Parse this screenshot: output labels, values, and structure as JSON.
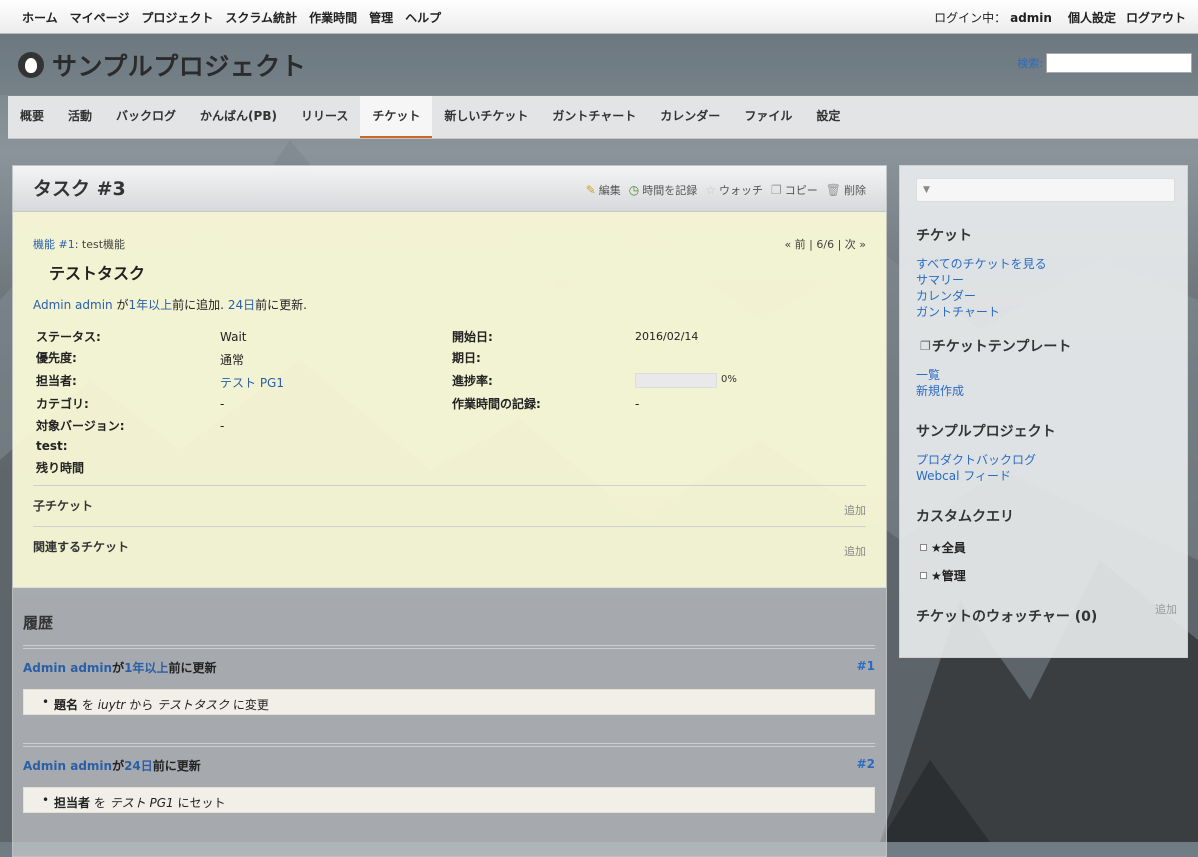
{
  "top_menu": {
    "items": [
      "ホーム",
      "マイページ",
      "プロジェクト",
      "スクラム統計",
      "作業時間",
      "管理",
      "ヘルプ"
    ],
    "logged_in_label": "ログイン中：",
    "user": "admin",
    "my_account": "個人設定",
    "logout": "ログアウト"
  },
  "header": {
    "project_name": "サンプルプロジェクト",
    "search_label": "検索:",
    "search_value": ""
  },
  "main_menu": {
    "tabs": [
      "概要",
      "活動",
      "バックログ",
      "かんばん(PB)",
      "リリース",
      "チケット",
      "新しいチケット",
      "ガントチャート",
      "カレンダー",
      "ファイル",
      "設定"
    ],
    "selected": "チケット"
  },
  "issue": {
    "title": "タスク #3",
    "actions": {
      "edit": "編集",
      "log_time": "時間を記録",
      "watch": "ウォッチ",
      "copy": "コピー",
      "delete": "削除"
    },
    "parent_link": "機能 #1",
    "parent_suffix": ": test機能",
    "nav": "« 前 | 6/6 | 次 »",
    "subject": "テストタスク",
    "author_name": "Admin admin",
    "author_ga": "が",
    "created_ago": "1年以上",
    "created_suffix": "前に追加.",
    "updated_ago": "24日",
    "updated_suffix": "前に更新.",
    "attrs_left": [
      {
        "label": "ステータス:",
        "value": "Wait"
      },
      {
        "label": "優先度:",
        "value": "通常"
      },
      {
        "label": "担当者:",
        "value": "テスト PG1"
      },
      {
        "label": "カテゴリ:",
        "value": "-"
      },
      {
        "label": "対象バージョン:",
        "value": "-"
      },
      {
        "label": "test:",
        "value": ""
      },
      {
        "label": "残り時間",
        "value": ""
      }
    ],
    "attrs_right": [
      {
        "label": "開始日:",
        "value": "2016/02/14"
      },
      {
        "label": "期日:",
        "value": ""
      },
      {
        "label": "進捗率:",
        "value": "0%"
      },
      {
        "label": "作業時間の記録:",
        "value": "-"
      }
    ],
    "progress_percent": 0,
    "subtasks_title": "子チケット",
    "relations_title": "関連するチケット",
    "add_label": "追加"
  },
  "history": {
    "title": "履歴",
    "journals": [
      {
        "user": "Admin admin",
        "ga": "が",
        "ago": "1年以上",
        "suffix": "前に更新",
        "num": "#1",
        "detail_field": "題名",
        "detail_wo": "を",
        "detail_old": "iuytr",
        "detail_from": "から",
        "detail_new": "テストタスク",
        "detail_end": "に変更"
      },
      {
        "user": "Admin admin",
        "ga": "が",
        "ago": "24日",
        "suffix": "前に更新",
        "num": "#2",
        "detail_field": "担当者",
        "detail_wo": "を",
        "detail_new": "テスト PG1",
        "detail_end": "にセット"
      }
    ]
  },
  "sidebar": {
    "tickets_title": "チケット",
    "ticket_links": [
      "すべてのチケットを見る",
      "サマリー",
      "カレンダー",
      "ガントチャート"
    ],
    "template_title": "チケットテンプレート",
    "template_links": [
      "一覧",
      "新規作成"
    ],
    "project_title": "サンプルプロジェクト",
    "project_links": [
      "プロダクトバックログ",
      "Webcal フィード"
    ],
    "custom_query_title": "カスタムクエリ",
    "custom_queries": [
      "★全員",
      "★管理"
    ],
    "watchers_title": "チケットのウォッチャー (0)",
    "watchers_add": "追加"
  }
}
